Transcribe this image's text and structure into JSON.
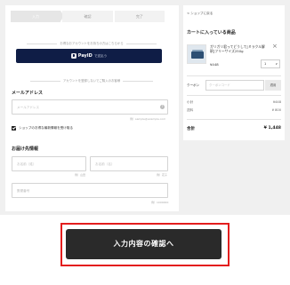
{
  "steps": [
    "入力",
    "確認",
    "完了"
  ],
  "account_hint": "お得なおアカウントをお持ちの方はこちらから",
  "payid": {
    "logo": "PayID",
    "label": "で支払う"
  },
  "guest_hint": "アカウントを登録しないでご購入のお客様",
  "email": {
    "title": "メールアドレス",
    "placeholder": "メールアドレス",
    "note": "例）sample@example.com"
  },
  "newsletter": {
    "label": "ショップのお得な最新情報を受け取る",
    "checked": true
  },
  "shipping": {
    "title": "お届け先情報",
    "last_name_placeholder": "お名前（姓）",
    "first_name_placeholder": "お名前（名）",
    "note1": "例）山田",
    "note2": "例）花子",
    "postal_placeholder": "郵便番号",
    "postal_note": "例）1000000"
  },
  "cart": {
    "back_link": "< ショップに戻る",
    "title": "カートに入っている商品",
    "item": {
      "name": "ガリガリ君ってどうして[ミラクル解釈]フリーサイズ250g",
      "price": "¥448",
      "quantity": "1"
    },
    "coupon_label": "クーポン",
    "coupon_placeholder": "クーポンコード",
    "coupon_button": "適用",
    "subtotal_label": "小計",
    "subtotal": "¥448",
    "shipping_label": "送料",
    "shipping_fee": "¥ 800",
    "total_label": "合計",
    "total": "¥ 1,448"
  },
  "cta_label": "入力内容の確認へ",
  "colors": {
    "cta": "#2a2a2a",
    "highlight": "#e31d1d",
    "payid": "#0f1d46"
  }
}
